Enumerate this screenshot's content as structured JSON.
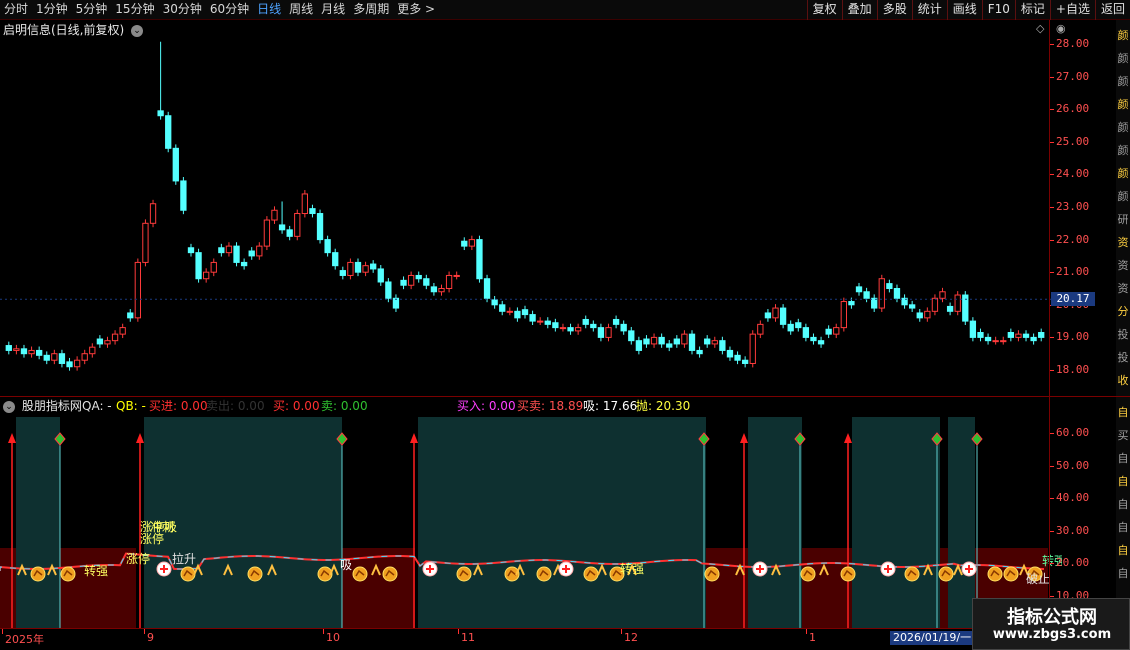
{
  "toolbar": {
    "periods": [
      "分时",
      "1分钟",
      "5分钟",
      "15分钟",
      "30分钟",
      "60分钟",
      "日线",
      "周线",
      "月线",
      "多周期",
      "更多 >"
    ],
    "active_period": "日线",
    "tools": [
      "复权",
      "叠加",
      "多股",
      "统计",
      "画线",
      "F10",
      "标记",
      "+自选",
      "返回"
    ]
  },
  "main_chart": {
    "title": "启明信息(日线,前复权)",
    "price_ticks": [
      "28.00",
      "27.00",
      "26.00",
      "25.00",
      "24.00",
      "23.00",
      "22.00",
      "21.00",
      "20.00",
      "19.00",
      "18.00"
    ],
    "current_price": "20.17",
    "colors": {
      "up": "#ff3b3b",
      "down": "#54ffff",
      "background": "#000000"
    }
  },
  "indicator": {
    "title": "股朋指标网",
    "fields": [
      {
        "label": "QA: -",
        "color": "#e0e0e0"
      },
      {
        "label": "QB: -",
        "color": "#ffff00"
      },
      {
        "label": "买进: 0.00",
        "color": "#ff3030"
      },
      {
        "label": "卖出: 0.00",
        "color": "#333333"
      },
      {
        "label": "买: 0.00",
        "color": "#ff3030"
      },
      {
        "label": "卖: 0.00",
        "color": "#30c030"
      },
      {
        "label": "买入: 0.00",
        "color": "#ff40ff"
      },
      {
        "label": "买卖: 18.89",
        "color": "#ff5050"
      },
      {
        "label": "吸: 17.66",
        "color": "#ffffff"
      },
      {
        "label": "抛: 20.30",
        "color": "#ffff40"
      }
    ],
    "axis_ticks": [
      "60.00",
      "50.00",
      "40.00",
      "30.00",
      "20.00",
      "10.00"
    ],
    "annotations": [
      "转强",
      "涨停",
      "涨停",
      "涨停",
      "拉升",
      "吸",
      "转强",
      "冲刺",
      "吸",
      "转强",
      "破止"
    ],
    "colors": {
      "zone": "#0e3030",
      "warm": "#4a0000",
      "arrow": "#ff2020",
      "tip": "#30c030"
    }
  },
  "date_axis": {
    "labels": [
      "2025年",
      "9",
      "10",
      "11",
      "12",
      "1"
    ],
    "cursor_date": "2026/01/19/一"
  },
  "side_strip_chars": [
    "颜",
    "颜",
    "颜",
    "颜",
    "颜",
    "颜",
    "颜",
    "颜",
    "研",
    "资",
    "资",
    "资",
    "分",
    "投",
    "投",
    "收"
  ],
  "side_strip_chars_lower": [
    "自",
    "买",
    "自",
    "自",
    "自",
    "自",
    "自",
    "自"
  ],
  "watermark": {
    "title": "指标公式网",
    "url": "www.zbgs3.com"
  }
}
